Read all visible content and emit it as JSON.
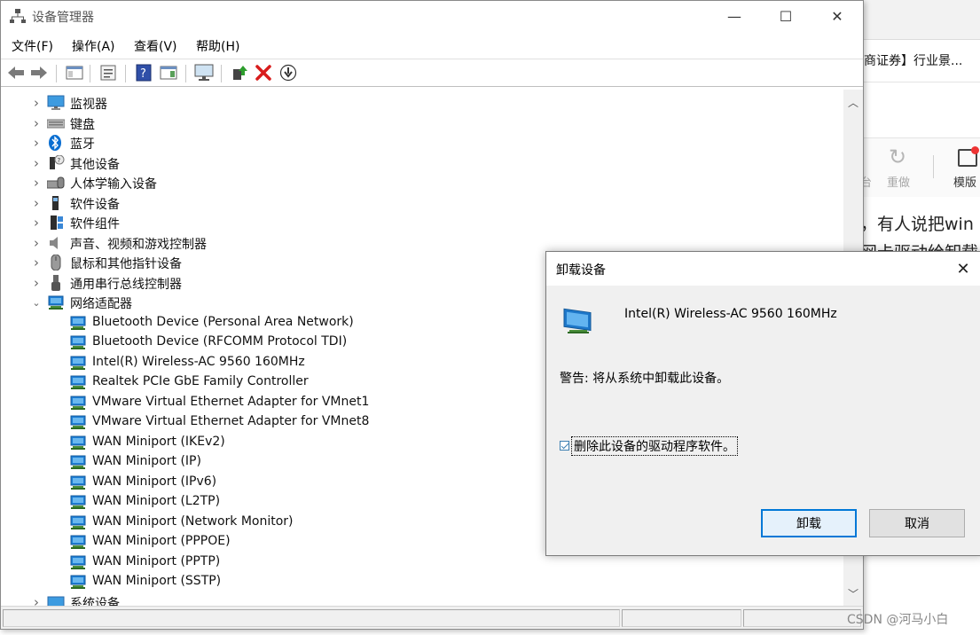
{
  "background_window": {
    "tab_text": "商证券】行业景...",
    "toolbar": {
      "cut_label": "台",
      "redo_label": "重做",
      "template_label": "模版"
    },
    "article_line1": "，有人说把win",
    "article_line2": "网卡驱动给卸载"
  },
  "watermark": "CSDN @河马小白",
  "device_manager": {
    "title": "设备管理器",
    "window_controls": {
      "minimize": "—",
      "maximize": "☐",
      "close": "✕"
    },
    "menu": [
      "文件(F)",
      "操作(A)",
      "查看(V)",
      "帮助(H)"
    ],
    "toolbar_icons": [
      "back-icon",
      "forward-icon",
      "show-hide-console-tree-icon",
      "properties-icon",
      "help-icon",
      "action-pane-icon",
      "monitor-icon",
      "update-driver-icon",
      "uninstall-icon",
      "download-icon"
    ],
    "categories": [
      {
        "label": "监视器",
        "icon": "monitor-icon",
        "expanded": false
      },
      {
        "label": "键盘",
        "icon": "keyboard-icon",
        "expanded": false
      },
      {
        "label": "蓝牙",
        "icon": "bluetooth-icon",
        "expanded": false
      },
      {
        "label": "其他设备",
        "icon": "unknown-device-icon",
        "expanded": false
      },
      {
        "label": "人体学输入设备",
        "icon": "hid-icon",
        "expanded": false
      },
      {
        "label": "软件设备",
        "icon": "software-device-icon",
        "expanded": false
      },
      {
        "label": "软件组件",
        "icon": "software-component-icon",
        "expanded": false
      },
      {
        "label": "声音、视频和游戏控制器",
        "icon": "speaker-icon",
        "expanded": false
      },
      {
        "label": "鼠标和其他指针设备",
        "icon": "mouse-icon",
        "expanded": false
      },
      {
        "label": "通用串行总线控制器",
        "icon": "usb-icon",
        "expanded": false
      },
      {
        "label": "网络适配器",
        "icon": "network-adapter-icon",
        "expanded": true
      }
    ],
    "network_adapters": [
      "Bluetooth Device (Personal Area Network)",
      "Bluetooth Device (RFCOMM Protocol TDI)",
      "Intel(R) Wireless-AC 9560 160MHz",
      "Realtek PCIe GbE Family Controller",
      "VMware Virtual Ethernet Adapter for VMnet1",
      "VMware Virtual Ethernet Adapter for VMnet8",
      "WAN Miniport (IKEv2)",
      "WAN Miniport (IP)",
      "WAN Miniport (IPv6)",
      "WAN Miniport (L2TP)",
      "WAN Miniport (Network Monitor)",
      "WAN Miniport (PPPOE)",
      "WAN Miniport (PPTP)",
      "WAN Miniport (SSTP)"
    ],
    "last_category": {
      "label": "系统设备",
      "icon": "system-device-icon"
    }
  },
  "uninstall_dialog": {
    "title": "卸载设备",
    "device_name": "Intel(R) Wireless-AC 9560 160MHz",
    "warning": "警告: 将从系统中卸载此设备。",
    "checkbox_label": "删除此设备的驱动程序软件。",
    "checkbox_checked": true,
    "uninstall_button": "卸载",
    "cancel_button": "取消"
  }
}
